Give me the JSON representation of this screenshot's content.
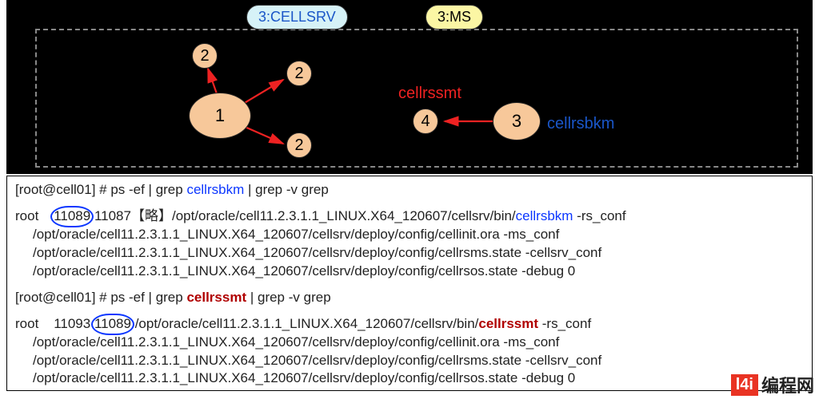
{
  "header": {
    "pill_cellsrv": "3:CELLSRV",
    "pill_ms": "3:MS"
  },
  "diagram": {
    "node_big": "1",
    "node_small_a": "2",
    "node_small_b": "2",
    "node_small_c": "2",
    "node_three": "3",
    "node_four": "4",
    "label_cellrssmt": "cellrssmt",
    "label_cellrsbkm": "cellrsbkm"
  },
  "term": {
    "cmd1_pre": "[root@cell01] # ps -ef | grep ",
    "cmd1_grep": "cellrsbkm",
    "cmd_suffix": " | grep -v grep",
    "out1_user": "root",
    "out1_pid": "11089",
    "out1_ppid": "11087",
    "out1_note": "【略】",
    "out1_path_pre": "/opt/oracle/cell11.2.3.1.1_LINUX.X64_120607/cellsrv/bin/",
    "out1_bin": "cellrsbkm",
    "out1_flag1": " -rs_conf",
    "out1_l2": "/opt/oracle/cell11.2.3.1.1_LINUX.X64_120607/cellsrv/deploy/config/cellinit.ora -ms_conf",
    "out1_l3": "/opt/oracle/cell11.2.3.1.1_LINUX.X64_120607/cellsrv/deploy/config/cellrsms.state -cellsrv_conf",
    "out1_l4": "/opt/oracle/cell11.2.3.1.1_LINUX.X64_120607/cellsrv/deploy/config/cellrsos.state -debug 0",
    "cmd2_pre": "[root@cell01] # ps -ef | grep ",
    "cmd2_grep": "cellrssmt",
    "out2_user": "root",
    "out2_pid": "11093",
    "out2_ppid": "11089",
    "out2_path_pre": " /opt/oracle/cell11.2.3.1.1_LINUX.X64_120607/cellsrv/bin/",
    "out2_bin": "cellrssmt",
    "out2_flag1": " -rs_conf",
    "out2_l2": "/opt/oracle/cell11.2.3.1.1_LINUX.X64_120607/cellsrv/deploy/config/cellinit.ora -ms_conf",
    "out2_l3": "/opt/oracle/cell11.2.3.1.1_LINUX.X64_120607/cellsrv/deploy/config/cellrsms.state -cellsrv_conf",
    "out2_l4": "/opt/oracle/cell11.2.3.1.1_LINUX.X64_120607/cellsrv/deploy/config/cellrsos.state -debug 0"
  },
  "logo": {
    "box": "l4i",
    "text": "编程网"
  },
  "chart_data": {
    "type": "diagram",
    "title": "Process relationship diagram",
    "nodes": [
      {
        "id": "1",
        "label": "1",
        "kind": "large-oval"
      },
      {
        "id": "2a",
        "label": "2",
        "kind": "small-oval"
      },
      {
        "id": "2b",
        "label": "2",
        "kind": "small-oval"
      },
      {
        "id": "2c",
        "label": "2",
        "kind": "small-oval"
      },
      {
        "id": "3",
        "label": "3",
        "kind": "med-oval",
        "tag": "cellrsbkm"
      },
      {
        "id": "4",
        "label": "4",
        "kind": "small-oval",
        "tag": "cellrssmt"
      }
    ],
    "edges": [
      {
        "from": "1",
        "to": "2a",
        "color": "red"
      },
      {
        "from": "1",
        "to": "2b",
        "color": "red"
      },
      {
        "from": "1",
        "to": "2c",
        "color": "red"
      },
      {
        "from": "3",
        "to": "4",
        "color": "red"
      }
    ],
    "header_pills": [
      "3:CELLSRV",
      "3:MS"
    ]
  }
}
